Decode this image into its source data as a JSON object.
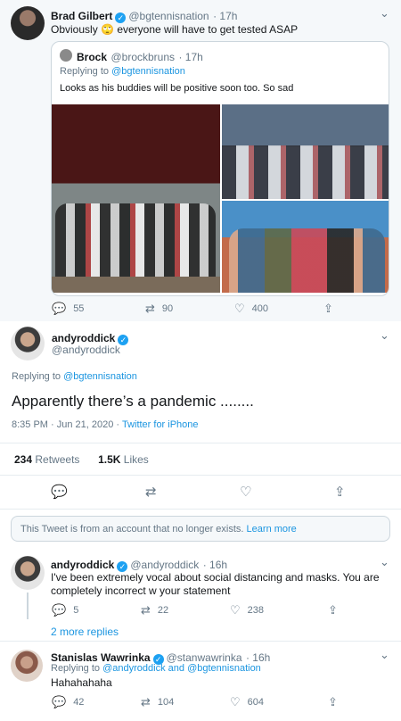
{
  "top_tweet": {
    "name": "Brad Gilbert",
    "handle": "@bgtennisnation",
    "time": "· 17h",
    "text_before": "Obviously",
    "emoji": "🙄",
    "text_after": "everyone will have to get tested ASAP",
    "quote": {
      "name": "Brock",
      "handle": "@brockbruns",
      "time": "· 17h",
      "replying_label": "Replying to",
      "replying_to": "@bgtennisnation",
      "text": "Looks as his buddies will be positive soon too. So sad"
    },
    "actions": {
      "replies": "55",
      "retweets": "90",
      "likes": "400"
    }
  },
  "main_tweet": {
    "name": "andyroddick",
    "handle": "@andyroddick",
    "replying_label": "Replying to",
    "replying_to": "@bgtennisnation",
    "text": "Apparently there’s a pandemic ........",
    "timestamp": "8:35 PM · Jun 21, 2020 ·",
    "source": "Twitter for iPhone",
    "retweets_count": "234",
    "retweets_label": "Retweets",
    "likes_count": "1.5K",
    "likes_label": "Likes"
  },
  "notice": {
    "text": "This Tweet is from an account that no longer exists.",
    "link": "Learn more"
  },
  "reply1": {
    "name": "andyroddick",
    "handle": "@andyroddick",
    "time": "· 16h",
    "text_line1": "I've been extremely vocal about social distancing and masks.  You are",
    "text_line2": "completely incorrect w your statement",
    "actions": {
      "replies": "5",
      "retweets": "22",
      "likes": "238"
    },
    "more": "2 more replies"
  },
  "reply2": {
    "name": "Stanislas Wawrinka",
    "handle": "@stanwawrinka",
    "time": "· 16h",
    "replying_label": "Replying to",
    "replying_to_1": "@andyroddick",
    "and": "and",
    "replying_to_2": "@bgtennisnation",
    "text": "Hahahahaha",
    "actions": {
      "replies": "42",
      "retweets": "104",
      "likes": "604"
    }
  },
  "icons": [
    "reply-icon",
    "retweet-icon",
    "like-icon",
    "share-icon",
    "verified-badge-icon",
    "chevron-down-icon"
  ],
  "colors": {
    "link": "#1b95e0",
    "verified": "#1da1f2",
    "muted": "#657786",
    "quoted_bg": "#f5f8fa"
  }
}
